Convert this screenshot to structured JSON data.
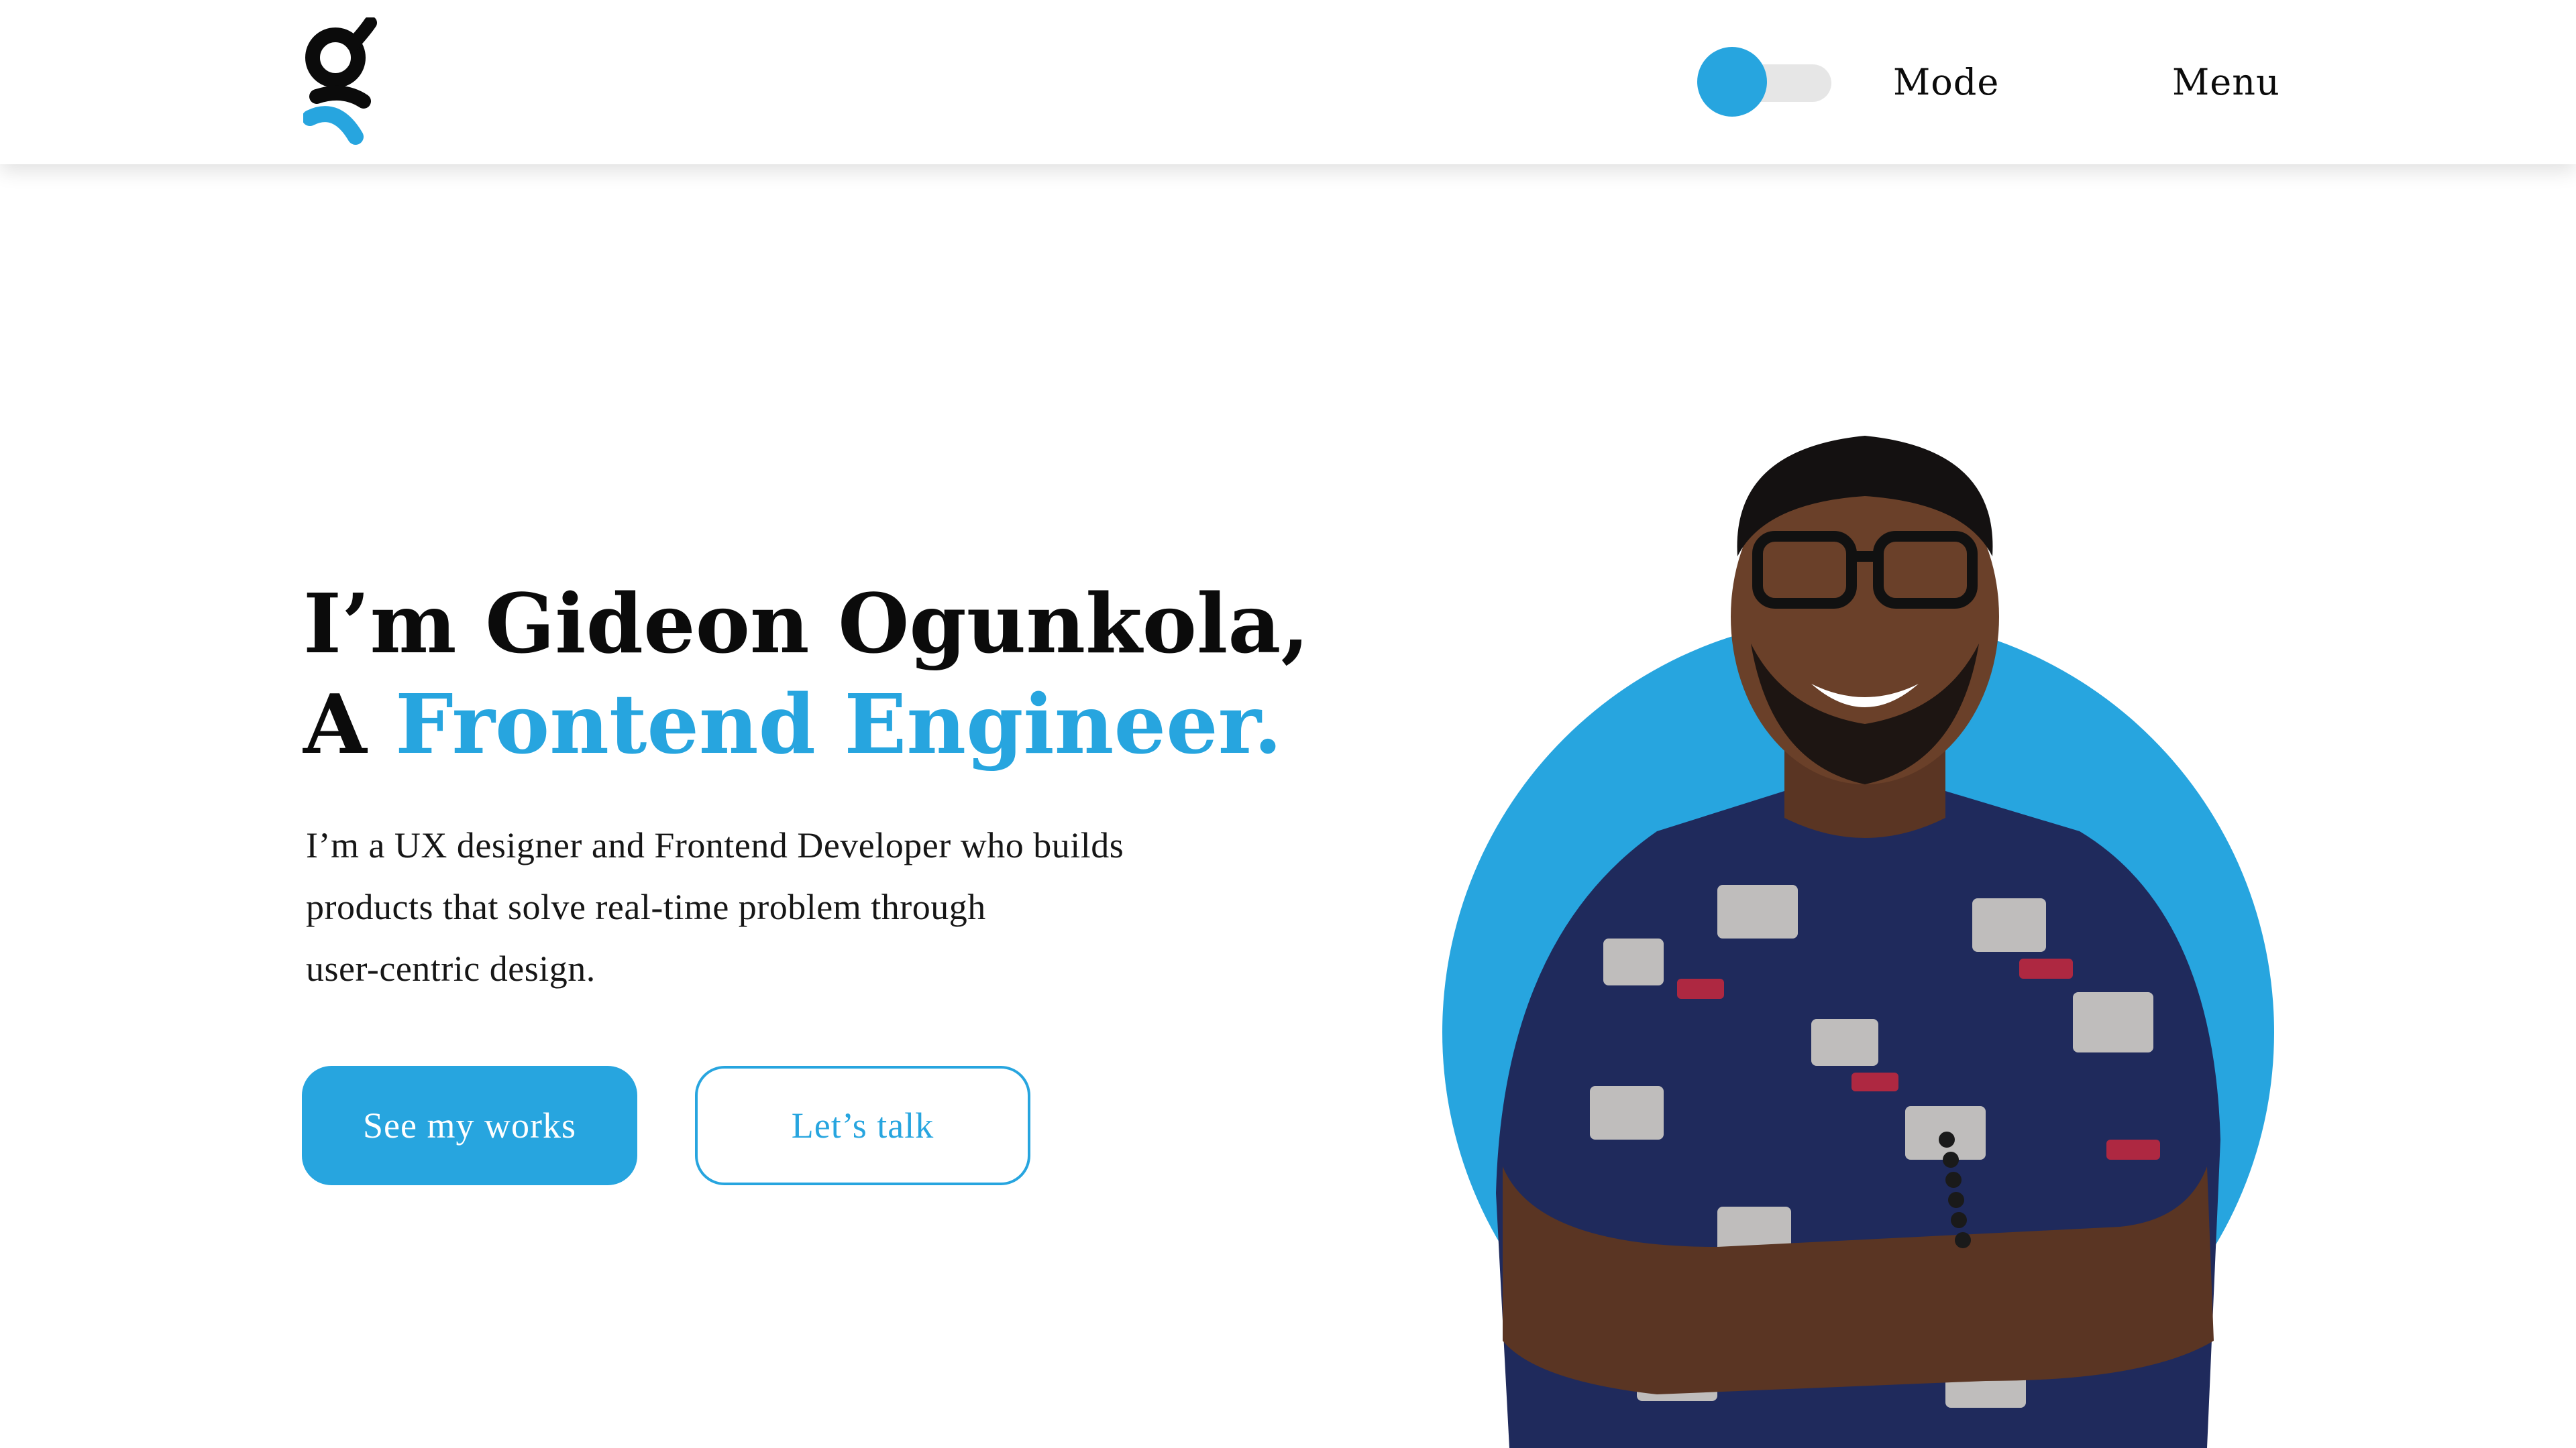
{
  "header": {
    "logo_icon": "g-letter-logo",
    "mode_label": "Mode",
    "menu_label": "Menu",
    "mode_toggle": {
      "state": "off",
      "knob_color": "#27a5df",
      "track_color": "#e6e6e6"
    }
  },
  "hero": {
    "title_line1": "I’m Gideon Ogunkola,",
    "title_line2_prefix": "A ",
    "title_line2_accent": "Frontend Engineer.",
    "description_line1": "I’m a UX designer and Frontend Developer who builds",
    "description_line2": "products that solve real-time problem through",
    "description_line3": "user-centric design.",
    "primary_button": "See my works",
    "secondary_button": "Let’s talk"
  },
  "portrait": {
    "image": "person-portrait",
    "circle_color": "#27a5df"
  },
  "colors": {
    "accent": "#27a5df",
    "text": "#0b0b0b",
    "background": "#ffffff"
  }
}
